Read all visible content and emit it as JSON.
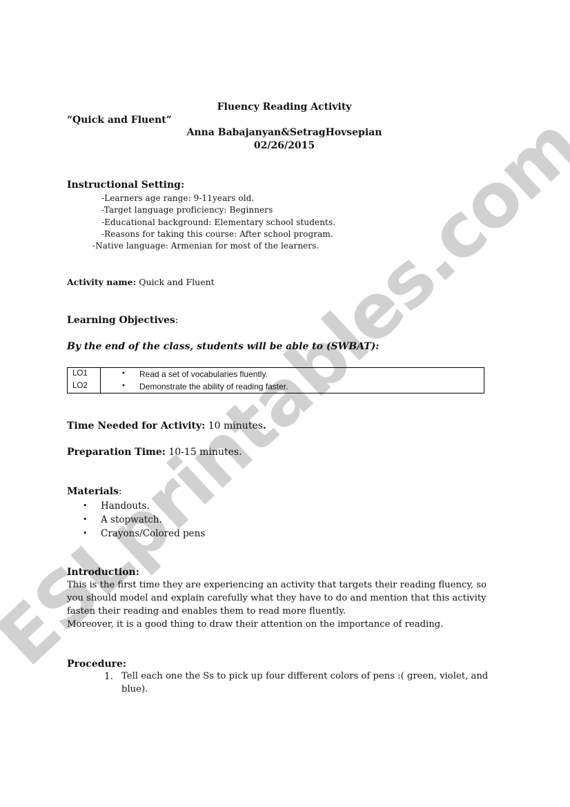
{
  "header": {
    "title": "Fluency Reading Activity",
    "subtitle": "“Quick and Fluent”",
    "authors": "Anna Babajanyan&SetragHovsepian",
    "date": "02/26/2015"
  },
  "instructional_setting": {
    "heading": "Instructional Setting:",
    "items": [
      "-Learners age range: 9-11years old.",
      "-Target language proficiency: Beginners",
      "-Educational background: Elementary school students.",
      "-Reasons for taking this course: After school program.",
      "-Native language: Armenian for most of the learners."
    ]
  },
  "activity_name": {
    "label": "Activity name:",
    "value": " Quick and Fluent"
  },
  "learning_objectives": {
    "heading": "Learning Objectives",
    "colon": ":",
    "swbat": "By the end of the class, students will be able to (SWBAT):",
    "rows": [
      {
        "code": "LO1",
        "bullet": "•",
        "text": "Read a set of vocabularies fluently."
      },
      {
        "code": "LO2",
        "bullet": "•",
        "text": "Demonstrate the ability of reading faster."
      }
    ]
  },
  "time_needed": {
    "label": "Time Needed for Activity:",
    "value": " 10 minutes",
    "period": "."
  },
  "preparation_time": {
    "label": "Preparation Time:",
    "value": " 10-15 minutes."
  },
  "materials": {
    "heading": "Materials",
    "colon": ":",
    "bullet": "•",
    "items": [
      "Handouts.",
      "A stopwatch.",
      "Crayons/Colored pens"
    ]
  },
  "introduction": {
    "heading": "Introduction:",
    "lines": [
      "This is the first time they are experiencing an activity that targets their reading fluency, so",
      "you should model and explain carefully what they have to do and mention that this activity",
      "fasten their reading and enables them to read more fluently.",
      "Moreover, it is a good thing to draw their attention on the importance of reading."
    ]
  },
  "procedure": {
    "heading": "Procedure:",
    "steps": [
      {
        "number": "1.",
        "lines": [
          "Tell each one the Ss to pick up four different colors of pens :( green, violet, and",
          "blue)."
        ]
      }
    ]
  },
  "watermark": {
    "text": "ESLprintables.com",
    "color": "#c9c9c9"
  }
}
